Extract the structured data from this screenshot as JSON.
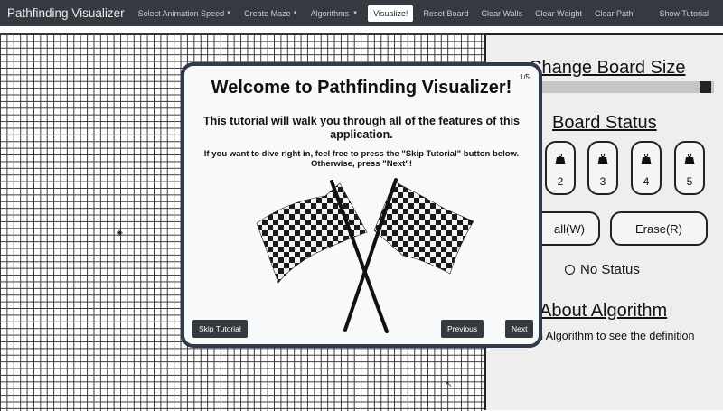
{
  "navbar": {
    "brand": "Pathfinding Visualizer",
    "items": [
      {
        "label": "Select Animation Speed",
        "dropdown": true
      },
      {
        "label": "Create Maze",
        "dropdown": true
      },
      {
        "label": "Algorithms",
        "dropdown": true
      }
    ],
    "visualize_label": "Visualize!",
    "actions": [
      "Reset Board",
      "Clear Walls",
      "Clear Weight",
      "Clear Path"
    ],
    "show_tutorial": "Show Tutorial"
  },
  "panel": {
    "board_size_heading": "Change Board Size",
    "board_status_heading": "Board Status",
    "weights": [
      "2",
      "3",
      "4",
      "5"
    ],
    "wall_button_label": "all(W)",
    "erase_button_label": "Erase(R)",
    "status_text": "No Status",
    "about_heading": "About Algorithm",
    "about_text": "n Algorithm to see the definition"
  },
  "modal": {
    "counter": "1/5",
    "title": "Welcome to Pathfinding Visualizer!",
    "subtitle": "This tutorial will walk you through all of the features of this application.",
    "note": "If you want to dive right in, feel free to press the \"Skip Tutorial\" button below. Otherwise, press \"Next\"!",
    "skip_label": "Skip Tutorial",
    "previous_label": "Previous",
    "next_label": "Next"
  },
  "colors": {
    "navbar_bg": "#343a40",
    "modal_border": "#2f3a4a",
    "panel_bg": "#eeeeee"
  }
}
